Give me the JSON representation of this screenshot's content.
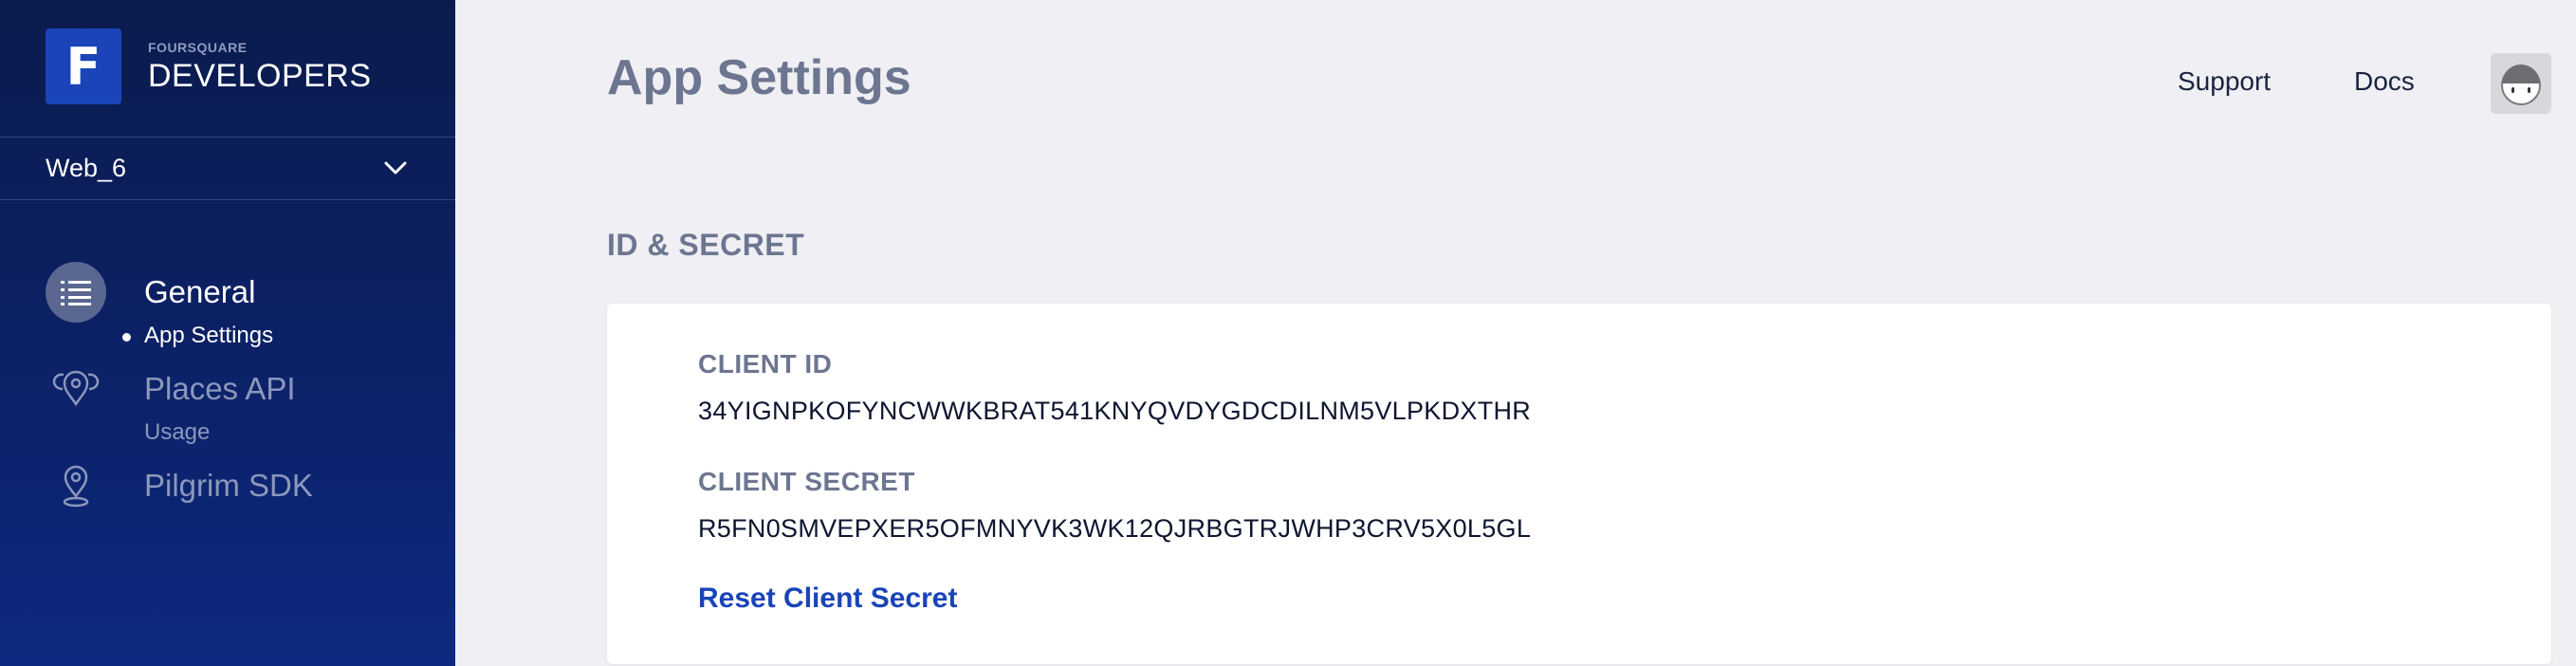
{
  "brand": {
    "logo_letter": "F",
    "small_text": "FOURSQUARE",
    "big_text": "DEVELOPERS"
  },
  "app_selector": {
    "value": "Web_6",
    "icon": "chevron-down-icon"
  },
  "sidebar": {
    "nav": [
      {
        "label": "General",
        "icon": "list-icon",
        "active": true,
        "sub": [
          {
            "label": "App Settings",
            "active": true
          }
        ]
      },
      {
        "label": "Places API",
        "icon": "places-pin-icon",
        "active": false,
        "sub": [
          {
            "label": "Usage",
            "active": false
          }
        ]
      },
      {
        "label": "Pilgrim SDK",
        "icon": "location-pin-icon",
        "active": false,
        "sub": []
      }
    ]
  },
  "header": {
    "title": "App Settings",
    "links": [
      "Support",
      "Docs"
    ],
    "avatar_icon": "user-avatar-icon"
  },
  "main": {
    "section_title": "ID & SECRET",
    "client_id_label": "CLIENT ID",
    "client_id_value": "34YIGNPKOFYNCWWKBRAT541KNYQVDYGDCDILNM5VLPKDXTHR",
    "client_secret_label": "CLIENT SECRET",
    "client_secret_value": "R5FN0SMVEPXER5OFMNYVK3WK12QJRBGTRJWHP3CRV5X0L5GL",
    "reset_label": "Reset Client Secret"
  },
  "colors": {
    "sidebar_top": "#0b1b4d",
    "sidebar_bottom": "#0d2a80",
    "accent": "#1a44b8",
    "page_bg": "#efeff4"
  }
}
